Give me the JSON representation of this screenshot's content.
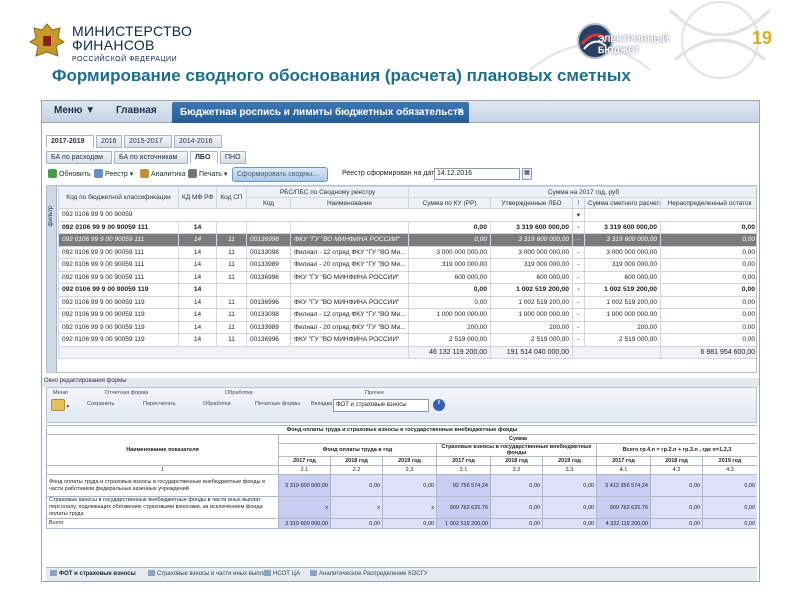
{
  "header": {
    "ministry_line1": "МИНИСТЕРСТВО",
    "ministry_line2": "ФИНАНСОВ",
    "ministry_line3": "РОССИЙСКОЙ ФЕДЕРАЦИИ",
    "eb_line1": "ЭЛЕКТРОННЫЙ",
    "eb_line2": "БЮДЖЕТ",
    "slide_number": "19",
    "slide_title": "Формирование сводного обоснования (расчета) плановых сметных"
  },
  "menubar": {
    "menu_label": "Меню ▼",
    "home_label": "Главная",
    "active_tab": "Бюджетная роспись и лимиты бюджетных обязательств",
    "close_glyph": "×"
  },
  "year_tabs": [
    "2017-2019",
    "2016",
    "2015-2017",
    "2014-2016"
  ],
  "sub_tabs": [
    "БА по расходам",
    "БА по источникам",
    "ЛБО",
    "ПНО"
  ],
  "toolbar": {
    "refresh": "Обновить",
    "registry": "Реестр ▾",
    "analytics": "Аналитика",
    "print": "Печать ▾",
    "form_summary": "Сформировать сводны...",
    "reg_label": "Реестр сформирован на дату:",
    "reg_date": "14.12.2016"
  },
  "grid": {
    "filter_label": "фильтр",
    "headers": {
      "code": "Код по бюджетной классификации",
      "kdmf": "КД МФ РФ",
      "kodsp": "Код СП",
      "rbs": "РБС/ПБС по Сводному реестру",
      "rbs_code": "Код",
      "rbs_name": "Наименование",
      "sum_group": "Сумма на 2017 год, руб",
      "sum_ku": "Сумма по КУ (РР)",
      "approved_lbo": "Утвержденные ЛБО",
      "excl": "!",
      "smeta": "Сумма сметного расчета",
      "unalloc": "Нераспределенный остаток"
    },
    "filter_value": "092 0106 99 9 00 90059",
    "rows": [
      {
        "type": "grp",
        "code": "092 0106 99 9 00 90059 111",
        "kdmf": "14",
        "kodsp": "",
        "rcode": "",
        "rname": "",
        "ku": "0,00",
        "lbo": "3 319 600 000,00",
        "x": "-",
        "smeta": "3 319 600 000,00",
        "rest": "0,00"
      },
      {
        "type": "sel",
        "code": "092 0106 99 9 00 90059 111",
        "kdmf": "14",
        "kodsp": "11",
        "rcode": "00136996",
        "rname": "ФКУ \"ГУ \"ВО МИНФИНА РОССИИ\"",
        "ku": "0,00",
        "lbo": "3 319 600 000,00",
        "x": "-",
        "smeta": "3 319 600 000,00",
        "rest": "0,00"
      },
      {
        "type": "row",
        "code": "092 0106 99 9 00 90059 111",
        "kdmf": "14",
        "kodsp": "11",
        "rcode": "00133098",
        "rname": "Филиал - 12 отряд ФКУ \"ГУ \"ВО Ми...",
        "ku": "3 000 000 000,00",
        "lbo": "3 000 000 000,00",
        "x": "-",
        "smeta": "3 000 000 000,00",
        "rest": "0,00"
      },
      {
        "type": "row",
        "code": "092 0106 99 9 00 90059 111",
        "kdmf": "14",
        "kodsp": "11",
        "rcode": "00133989",
        "rname": "Филиал - 20 отряд ФКУ \"ГУ \"ВО Ми...",
        "ku": "319 000 000,00",
        "lbo": "319 000 000,00",
        "x": "-",
        "smeta": "319 000 000,00",
        "rest": "0,00"
      },
      {
        "type": "row",
        "code": "092 0106 99 9 00 90059 111",
        "kdmf": "14",
        "kodsp": "11",
        "rcode": "00136996",
        "rname": "ФКУ \"ГУ \"ВО МИНФИНА РОССИИ\"",
        "ku": "600 000,00",
        "lbo": "600 000,00",
        "x": "-",
        "smeta": "600 000,00",
        "rest": "0,00"
      },
      {
        "type": "grp",
        "code": "092 0106 99 9 00 90059 119",
        "kdmf": "14",
        "kodsp": "",
        "rcode": "",
        "rname": "",
        "ku": "0,00",
        "lbo": "1 002 519 200,00",
        "x": "-",
        "smeta": "1 002 519 200,00",
        "rest": "0,00"
      },
      {
        "type": "row",
        "code": "092 0106 99 9 00 90059 119",
        "kdmf": "14",
        "kodsp": "11",
        "rcode": "00136996",
        "rname": "ФКУ \"ГУ \"ВО МИНФИНА РОССИИ\"",
        "ku": "0,00",
        "lbo": "1 002 519 200,00",
        "x": "-",
        "smeta": "1 002 519 200,00",
        "rest": "0,00"
      },
      {
        "type": "row",
        "code": "092 0106 99 9 00 90059 119",
        "kdmf": "14",
        "kodsp": "11",
        "rcode": "00133098",
        "rname": "Филиал - 12 отряд ФКУ \"ГУ \"ВО Ми...",
        "ku": "1 000 000 000,00",
        "lbo": "1 000 000 000,00",
        "x": "-",
        "smeta": "1 000 000 000,00",
        "rest": "0,00"
      },
      {
        "type": "row",
        "code": "092 0106 99 9 00 90059 119",
        "kdmf": "14",
        "kodsp": "11",
        "rcode": "00133989",
        "rname": "Филиал - 20 отряд ФКУ \"ГУ \"ВО Ми...",
        "ku": "200,00",
        "lbo": "200,00",
        "x": "-",
        "smeta": "200,00",
        "rest": "0,00"
      },
      {
        "type": "row",
        "code": "092 0106 99 9 00 90059 119",
        "kdmf": "14",
        "kodsp": "11",
        "rcode": "00136996",
        "rname": "ФКУ \"ГУ \"ВО МИНФИНА РОССИИ\"",
        "ku": "2 519 000,00",
        "lbo": "2 519 000,00",
        "x": "-",
        "smeta": "2 519 000,00",
        "rest": "0,00"
      }
    ],
    "totals": {
      "ku": "46 132 119 200,00",
      "lbo": "191 514 040 000,00",
      "rest": "6 981 954 600,00"
    }
  },
  "edit_form": {
    "title": "Окно редактирования формы",
    "group_menu": "Меню",
    "group_report": "Отчетная форма",
    "group_processing": "Обработки",
    "group_other": "Прочее",
    "save": "Сохранить",
    "recalc": "Пересчитать",
    "processing_btn": "Обработки",
    "print_forms": "Печатные формы",
    "tab_label": "Вкладка",
    "tab_value": "ФОТ и страховые взносы"
  },
  "form_table": {
    "title": "Фонд оплаты труда и страховые взносы в государственные внебюджетные фонды",
    "indicator": "Наименование показателя",
    "sum": "Сумма",
    "fot_year": "Фонд оплаты труда в год",
    "ins": "Страховые взносы в государственные внебюджетные фонды",
    "total_formula": "Всего гр.4.n = гр.2.n + гр.3.n , где n=1,2,3",
    "years": [
      "2017 год",
      "2018 год",
      "2019 год",
      "2017 год",
      "2018 год",
      "2019 год",
      "2017 год",
      "2018 год",
      "2019 год"
    ],
    "nums": [
      "1",
      "2.1",
      "2.2",
      "2.3",
      "3.1",
      "3.2",
      "3.3",
      "4.1",
      "4.2",
      "4.3"
    ],
    "rows": [
      {
        "label": "Фонд оплаты труда и страховые взносы в государственные внебюджетные фонды в части работников федеральных казенных учреждений",
        "vals": [
          "3 319 600 000,00",
          "0,00",
          "0,00",
          "92 756 574,24",
          "0,00",
          "0,00",
          "3 412 356 574,24",
          "0,00",
          "0,00"
        ]
      },
      {
        "label": "Страховые взносы в государственные внебюджетные фонды в части иных выплат персоналу, подлежащих обложению страховыми взносами, за исключением фонда оплаты труда",
        "vals": [
          "x",
          "x",
          "x",
          "909 762 625,76",
          "0,00",
          "0,00",
          "909 762 625,76",
          "0,00",
          "0,00"
        ]
      },
      {
        "label": "Всего",
        "vals": [
          "3 319 600 000,00",
          "0,00",
          "0,00",
          "1 002 519 200,00",
          "0,00",
          "0,00",
          "4 322 119 200,00",
          "0,00",
          "0,00"
        ]
      }
    ]
  },
  "bottom_tabs": [
    "ФОТ и страховые взносы",
    "Страховые взносы в части иных выплат",
    "НСОТ ЦА",
    "Аналитическое Распределение КОСГУ"
  ],
  "colors": {
    "title": "#1d6f8c",
    "tab_active": "#2f69a6",
    "selected_row": "#7b7b7b",
    "cell_fill": "#c9cdf3",
    "slide_number": "#d9a928"
  }
}
